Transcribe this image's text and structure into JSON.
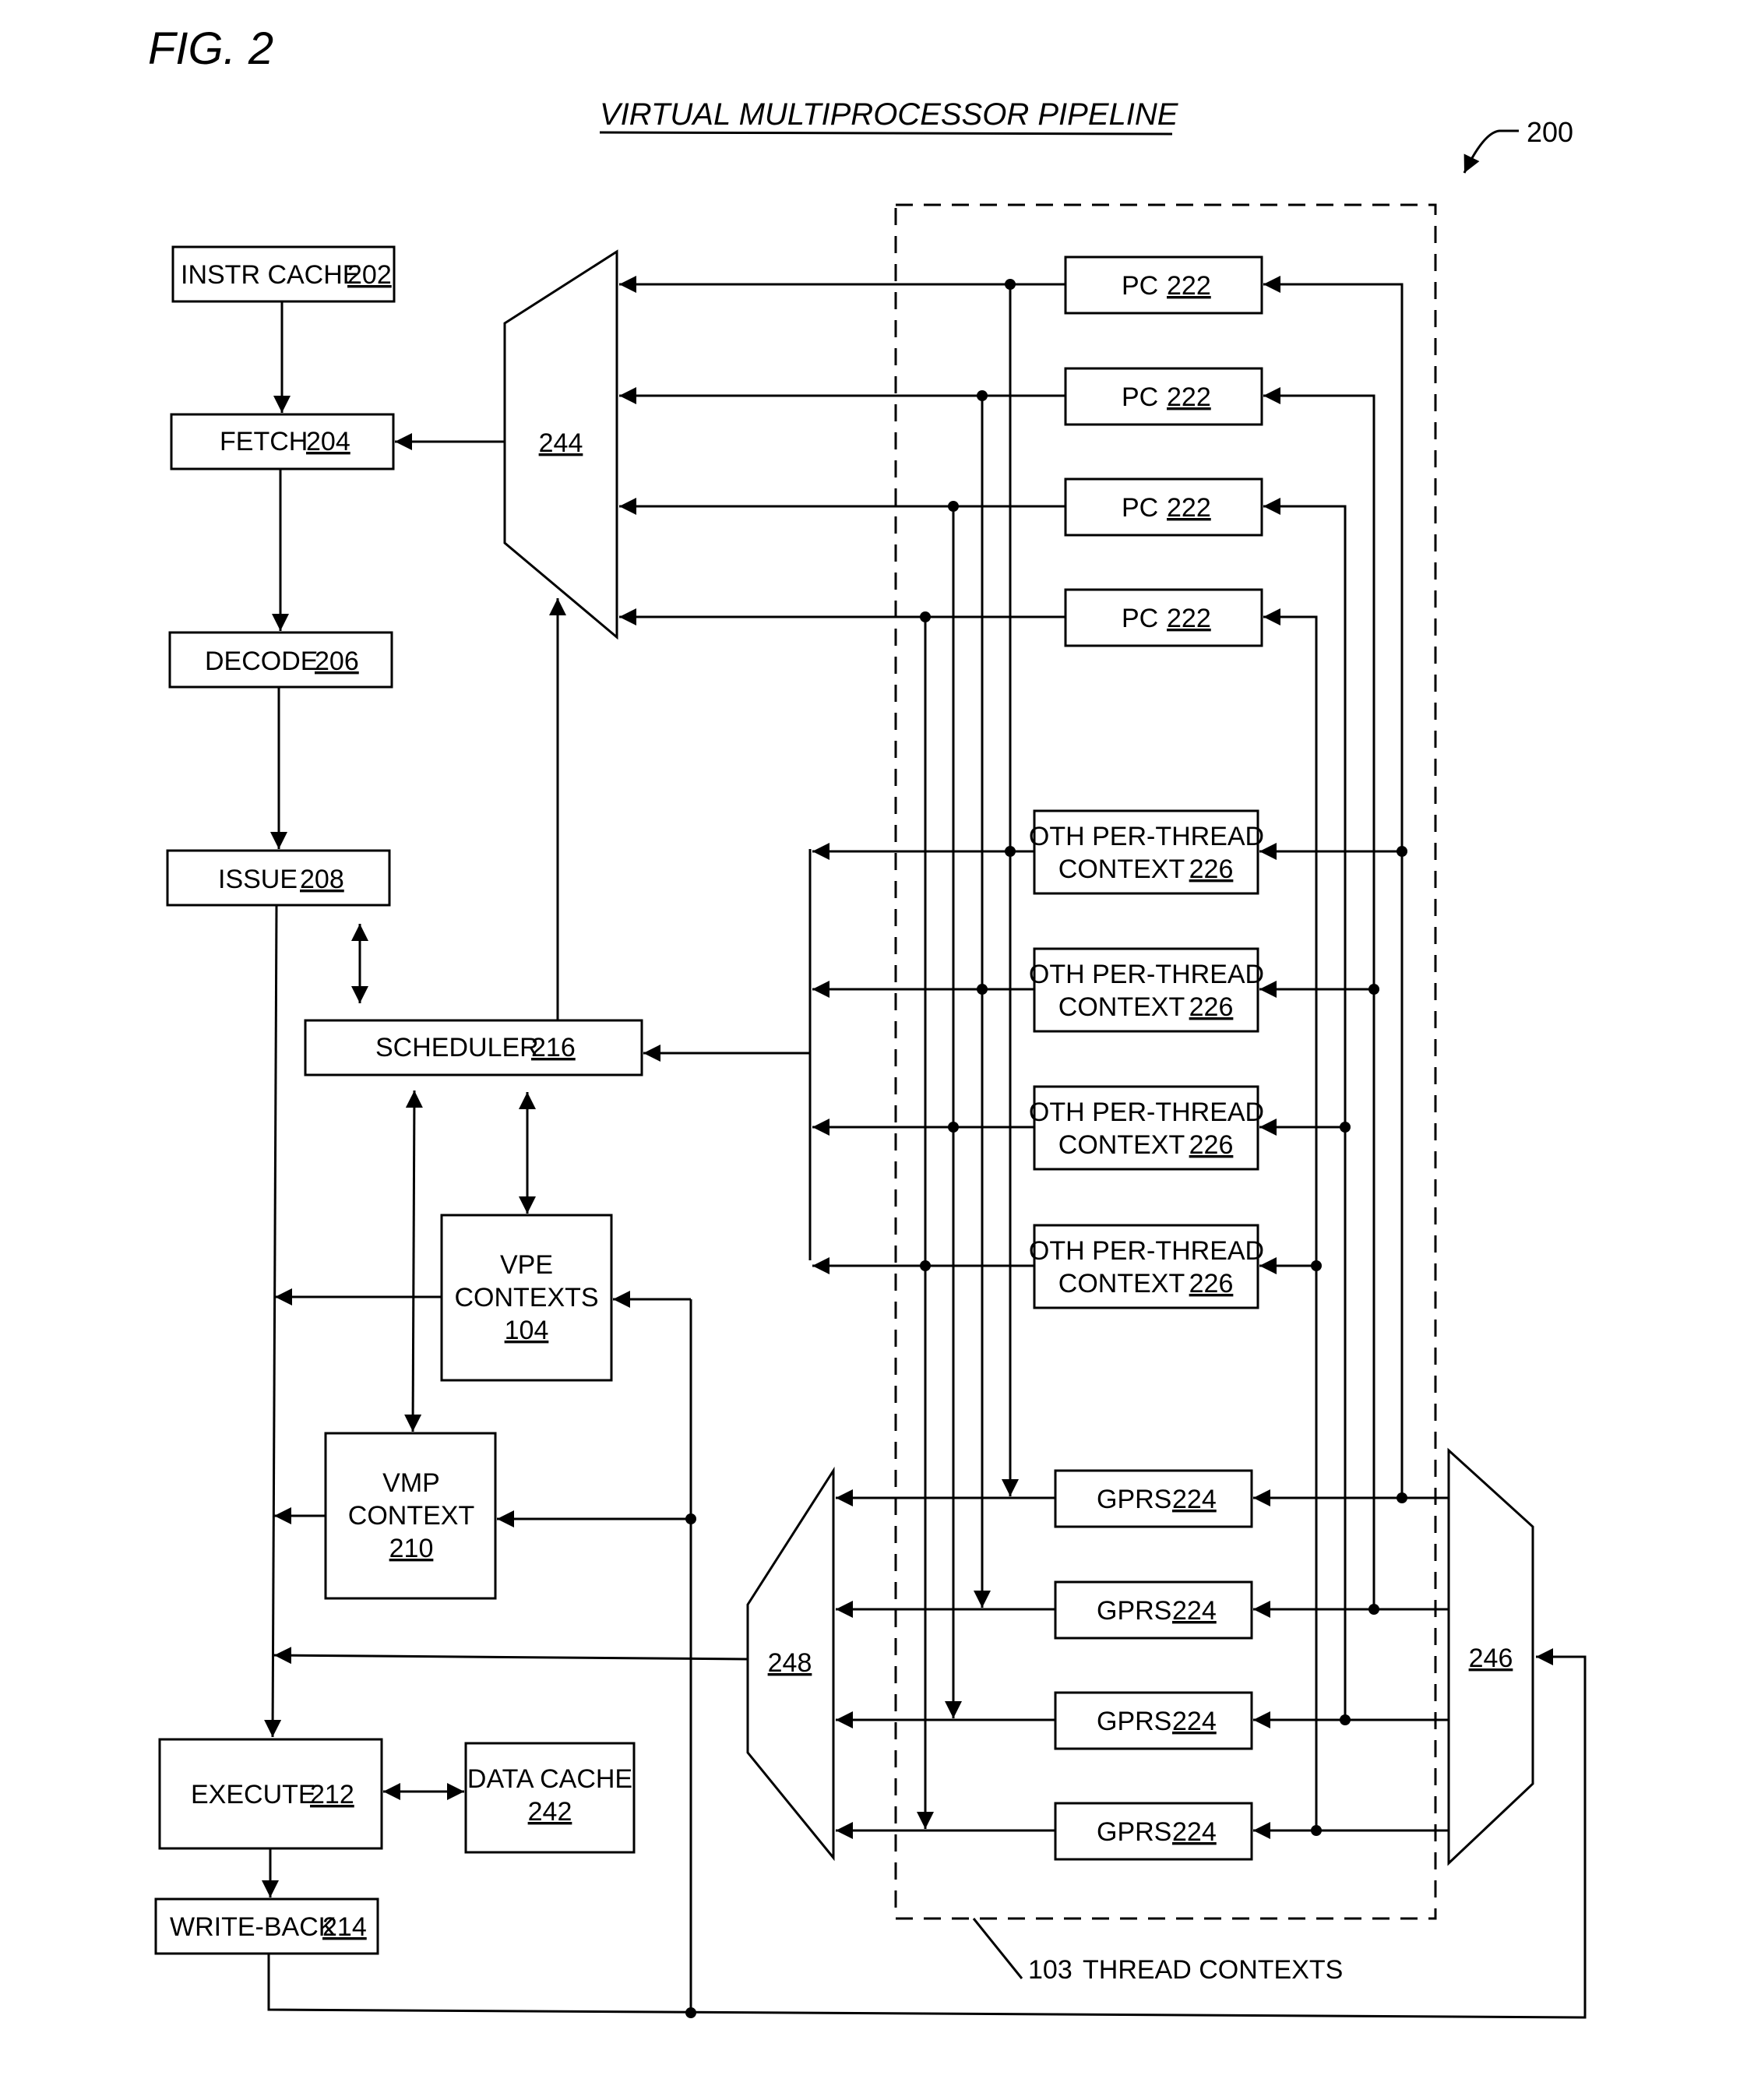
{
  "figure": {
    "number": "FIG. 2",
    "title": "VIRTUAL MULTIPROCESSOR PIPELINE",
    "ref": "200"
  },
  "blocks": {
    "instr_cache": {
      "label": "INSTR CACHE",
      "ref": "202"
    },
    "fetch": {
      "label": "FETCH",
      "ref": "204"
    },
    "decode": {
      "label": "DECODE",
      "ref": "206"
    },
    "issue": {
      "label": "ISSUE",
      "ref": "208"
    },
    "scheduler": {
      "label": "SCHEDULER",
      "ref": "216"
    },
    "vpe_contexts": {
      "line1": "VPE",
      "line2": "CONTEXTS",
      "ref": "104"
    },
    "vmp_context": {
      "line1": "VMP",
      "line2": "CONTEXT",
      "ref": "210"
    },
    "execute": {
      "label": "EXECUTE",
      "ref": "212"
    },
    "data_cache": {
      "label": "DATA CACHE",
      "ref": "242"
    },
    "write_back": {
      "label": "WRITE-BACK",
      "ref": "214"
    },
    "mux_244": {
      "ref": "244"
    },
    "mux_248": {
      "ref": "248"
    },
    "mux_246": {
      "ref": "246"
    }
  },
  "thread_contexts": {
    "label": "THREAD CONTEXTS",
    "ref": "103",
    "pc": [
      {
        "label": "PC",
        "ref": "222"
      },
      {
        "label": "PC",
        "ref": "222"
      },
      {
        "label": "PC",
        "ref": "222"
      },
      {
        "label": "PC",
        "ref": "222"
      }
    ],
    "oth": [
      {
        "line1": "OTH PER-THREAD",
        "line2": "CONTEXT",
        "ref": "226"
      },
      {
        "line1": "OTH PER-THREAD",
        "line2": "CONTEXT",
        "ref": "226"
      },
      {
        "line1": "OTH PER-THREAD",
        "line2": "CONTEXT",
        "ref": "226"
      },
      {
        "line1": "OTH PER-THREAD",
        "line2": "CONTEXT",
        "ref": "226"
      }
    ],
    "gprs": [
      {
        "label": "GPRS",
        "ref": "224"
      },
      {
        "label": "GPRS",
        "ref": "224"
      },
      {
        "label": "GPRS",
        "ref": "224"
      },
      {
        "label": "GPRS",
        "ref": "224"
      }
    ]
  }
}
